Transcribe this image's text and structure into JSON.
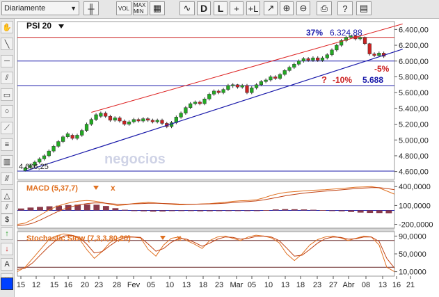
{
  "toolbar": {
    "period_label": "Diariamente",
    "buttons": [
      {
        "name": "candlestick-button",
        "label": "╫"
      },
      {
        "name": "volume-button",
        "label": "VOL"
      },
      {
        "name": "max-min-button",
        "label": "MAX MIN"
      },
      {
        "name": "grid-button",
        "label": "▦"
      },
      {
        "name": "indicators-button",
        "label": "∿"
      },
      {
        "name": "draw-button",
        "label": "D"
      },
      {
        "name": "line-button",
        "label": "L"
      },
      {
        "name": "crosshair-button",
        "label": "+"
      },
      {
        "name": "crosshair-label-button",
        "label": "+L"
      },
      {
        "name": "trend-button",
        "label": "↗"
      },
      {
        "name": "zoom-in-button",
        "label": "⊕"
      },
      {
        "name": "zoom-out-button",
        "label": "⊖"
      },
      {
        "name": "print-button",
        "label": "⎙"
      },
      {
        "name": "help-button",
        "label": "?"
      },
      {
        "name": "settings-button",
        "label": "▤"
      }
    ]
  },
  "sidebar": {
    "tools": [
      {
        "name": "hand-tool",
        "label": "✋"
      },
      {
        "name": "line-tool",
        "label": "╲"
      },
      {
        "name": "horizontal-line-tool",
        "label": "─"
      },
      {
        "name": "parallel-lines-tool",
        "label": "⫽"
      },
      {
        "name": "rectangle-tool",
        "label": "▭"
      },
      {
        "name": "circle-tool",
        "label": "○"
      },
      {
        "name": "fan-tool",
        "label": "⟋"
      },
      {
        "name": "fibonacci-tool",
        "label": "≡"
      },
      {
        "name": "fibonacci-grid-tool",
        "label": "▥"
      },
      {
        "name": "channel-tool",
        "label": "⫻"
      },
      {
        "name": "triangle-tool",
        "label": "△"
      },
      {
        "name": "channel2-tool",
        "label": "⫽"
      },
      {
        "name": "dollar-tool",
        "label": "$"
      },
      {
        "name": "buy-arrow-tool",
        "label": "↑"
      },
      {
        "name": "sell-arrow-tool",
        "label": "↓"
      },
      {
        "name": "text-tool",
        "label": "A"
      },
      {
        "name": "delete-tool",
        "label": "×"
      }
    ]
  },
  "chart_data": {
    "price": {
      "type": "candlestick",
      "title": "PSI 20",
      "ylim": [
        4500,
        6500
      ],
      "yticks": [
        "4.600,00",
        "4.800,00",
        "5.000,00",
        "5.200,00",
        "5.400,00",
        "5.600,00",
        "5.800,00",
        "6.000,00",
        "6.200,00",
        "6.400,00"
      ],
      "ytick_values": [
        4600,
        4800,
        5000,
        5200,
        5400,
        5600,
        5800,
        6000,
        6200,
        6400
      ],
      "xticks": [
        "15",
        "12",
        "15",
        "16",
        "20",
        "23",
        "28",
        "Fev",
        "05",
        "10",
        "13",
        "18",
        "23",
        "Mar",
        "05",
        "10",
        "13",
        "18",
        "23",
        "27",
        "Abr",
        "08",
        "13",
        "16",
        "21"
      ],
      "candles": [
        [
          4610,
          4650,
          4600,
          4660
        ],
        [
          4650,
          4680,
          4640,
          4700
        ],
        [
          4680,
          4720,
          4660,
          4740
        ],
        [
          4720,
          4760,
          4700,
          4780
        ],
        [
          4760,
          4800,
          4740,
          4820
        ],
        [
          4800,
          4860,
          4780,
          4880
        ],
        [
          4860,
          4920,
          4840,
          4940
        ],
        [
          4920,
          4980,
          4900,
          5000
        ],
        [
          4980,
          5040,
          4960,
          5060
        ],
        [
          5040,
          5080,
          5020,
          5100
        ],
        [
          5060,
          5020,
          5000,
          5080
        ],
        [
          5020,
          5060,
          5000,
          5080
        ],
        [
          5060,
          5120,
          5040,
          5140
        ],
        [
          5120,
          5200,
          5100,
          5220
        ],
        [
          5200,
          5260,
          5180,
          5280
        ],
        [
          5260,
          5320,
          5240,
          5340
        ],
        [
          5300,
          5340,
          5280,
          5360
        ],
        [
          5340,
          5300,
          5280,
          5360
        ],
        [
          5300,
          5250,
          5230,
          5320
        ],
        [
          5250,
          5280,
          5230,
          5300
        ],
        [
          5280,
          5240,
          5220,
          5300
        ],
        [
          5240,
          5200,
          5180,
          5260
        ],
        [
          5200,
          5230,
          5180,
          5250
        ],
        [
          5230,
          5260,
          5210,
          5280
        ],
        [
          5260,
          5240,
          5220,
          5280
        ],
        [
          5240,
          5270,
          5220,
          5290
        ],
        [
          5270,
          5250,
          5230,
          5290
        ],
        [
          5250,
          5230,
          5210,
          5270
        ],
        [
          5230,
          5250,
          5210,
          5270
        ],
        [
          5250,
          5210,
          5190,
          5270
        ],
        [
          5210,
          5170,
          5150,
          5230
        ],
        [
          5170,
          5220,
          5150,
          5240
        ],
        [
          5220,
          5290,
          5200,
          5310
        ],
        [
          5290,
          5340,
          5270,
          5360
        ],
        [
          5340,
          5410,
          5320,
          5430
        ],
        [
          5410,
          5460,
          5390,
          5480
        ],
        [
          5460,
          5480,
          5440,
          5500
        ],
        [
          5480,
          5460,
          5440,
          5500
        ],
        [
          5460,
          5520,
          5440,
          5540
        ],
        [
          5520,
          5580,
          5500,
          5600
        ],
        [
          5580,
          5620,
          5560,
          5640
        ],
        [
          5620,
          5600,
          5580,
          5640
        ],
        [
          5600,
          5640,
          5580,
          5660
        ],
        [
          5640,
          5690,
          5620,
          5710
        ],
        [
          5690,
          5700,
          5660,
          5720
        ],
        [
          5700,
          5670,
          5650,
          5710
        ],
        [
          5670,
          5690,
          5650,
          5710
        ],
        [
          5690,
          5600,
          5580,
          5710
        ],
        [
          5600,
          5660,
          5580,
          5680
        ],
        [
          5660,
          5700,
          5640,
          5720
        ],
        [
          5700,
          5740,
          5680,
          5760
        ],
        [
          5740,
          5760,
          5720,
          5780
        ],
        [
          5760,
          5800,
          5740,
          5820
        ],
        [
          5800,
          5780,
          5760,
          5820
        ],
        [
          5780,
          5830,
          5760,
          5850
        ],
        [
          5830,
          5880,
          5810,
          5900
        ],
        [
          5880,
          5920,
          5860,
          5940
        ],
        [
          5920,
          5960,
          5900,
          5980
        ],
        [
          5960,
          6000,
          5940,
          6020
        ],
        [
          6000,
          6030,
          5980,
          6050
        ],
        [
          6030,
          6010,
          5990,
          6050
        ],
        [
          6010,
          6040,
          5990,
          6060
        ],
        [
          6040,
          6010,
          5990,
          6060
        ],
        [
          6010,
          6040,
          5990,
          6060
        ],
        [
          6040,
          6080,
          6020,
          6100
        ],
        [
          6080,
          6140,
          6060,
          6160
        ],
        [
          6140,
          6200,
          6120,
          6220
        ],
        [
          6200,
          6260,
          6180,
          6280
        ],
        [
          6260,
          6300,
          6240,
          6320
        ],
        [
          6300,
          6320,
          6280,
          6324.88
        ],
        [
          6320,
          6280,
          6260,
          6324
        ],
        [
          6280,
          6300,
          6260,
          6320
        ],
        [
          6300,
          6220,
          6200,
          6310
        ],
        [
          6220,
          6090,
          6070,
          6230
        ],
        [
          6090,
          6070,
          6050,
          6110
        ],
        [
          6070,
          6100,
          6050,
          6120
        ],
        [
          6100,
          6060,
          6040,
          6120
        ]
      ],
      "annotations": {
        "high_pct": "37%",
        "high_value": "6.324,88",
        "minus5": "-5%",
        "question": "?",
        "minus10": "-10%",
        "target": "5.688",
        "low_value": "4.606,25"
      },
      "hlines": [
        6300,
        6000,
        5688,
        4606.25
      ],
      "channel_top": [
        [
          14,
          5350
        ],
        [
          80,
          6470
        ]
      ],
      "channel_bottom": [
        [
          0,
          4606
        ],
        [
          80,
          6150
        ]
      ],
      "watermark": "negocios"
    },
    "macd": {
      "title": "MACD (5,37,7)",
      "close_symbol": "x",
      "ylim": [
        -260000,
        480000
      ],
      "yticks": [
        "400,0000",
        "100,0000",
        "-200,0000"
      ],
      "ytick_values": [
        400000,
        100000,
        -200000
      ],
      "line": [
        -200000,
        -180000,
        -120000,
        -50000,
        20000,
        80000,
        120000,
        150000,
        170000,
        180000,
        170000,
        150000,
        120000,
        100000,
        110000,
        130000,
        140000,
        150000,
        140000,
        130000,
        120000,
        110000,
        115000,
        120000,
        125000,
        130000,
        140000,
        150000,
        165000,
        175000,
        180000,
        190000,
        220000,
        260000,
        290000,
        310000,
        320000,
        330000,
        340000,
        345000,
        350000,
        360000,
        370000,
        380000,
        390000,
        395000,
        400000,
        380000,
        330000,
        280000
      ],
      "signal": [
        -220000,
        -210000,
        -180000,
        -130000,
        -70000,
        -10000,
        40000,
        80000,
        110000,
        130000,
        140000,
        140000,
        130000,
        120000,
        120000,
        125000,
        130000,
        135000,
        135000,
        132000,
        128000,
        122000,
        120000,
        120000,
        122000,
        125000,
        130000,
        137000,
        146000,
        155000,
        163000,
        172000,
        188000,
        210000,
        235000,
        258000,
        276000,
        292000,
        306000,
        318000,
        328000,
        338000,
        348000,
        358000,
        368000,
        376000,
        384000,
        383000,
        370000,
        350000
      ],
      "hist": [
        30000,
        45000,
        55000,
        65000,
        75000,
        85000,
        90000,
        95000,
        90000,
        70000,
        35000,
        10000,
        -5000,
        -15000,
        -20000,
        -18000,
        -12000,
        -8000,
        -10000,
        -15000,
        -14000,
        -12000,
        -10000,
        -8000,
        -5000,
        -3000,
        5000,
        15000,
        20000,
        18000,
        15000,
        10000,
        5000,
        -5000,
        -15000,
        -25000,
        -35000,
        -40000,
        -42000,
        -45000
      ]
    },
    "stochastic": {
      "title": "Stochastic Slow (7,3,3,80,20)",
      "close_symbol": "x",
      "ylim": [
        0,
        100000
      ],
      "yticks": [
        "90,0000",
        "50,0000",
        "10,0000"
      ],
      "ytick_values": [
        90000,
        50000,
        10000
      ],
      "upper": 80000,
      "lower": 20000,
      "k": [
        10000,
        20000,
        40000,
        60000,
        80000,
        90000,
        95000,
        92000,
        85000,
        60000,
        40000,
        55000,
        75000,
        85000,
        90000,
        88000,
        86000,
        60000,
        45000,
        70000,
        85000,
        88000,
        80000,
        72000,
        62000,
        80000,
        88000,
        90000,
        85000,
        80000,
        88000,
        92000,
        90000,
        86000,
        75000,
        50000,
        35000,
        50000,
        70000,
        82000,
        88000,
        90000,
        86000,
        80000,
        85000,
        90000,
        88000,
        70000,
        20000,
        10000
      ],
      "d": [
        15000,
        18000,
        30000,
        48000,
        65000,
        80000,
        90000,
        92000,
        88000,
        72000,
        52000,
        55000,
        68000,
        80000,
        87000,
        88000,
        87000,
        72000,
        56000,
        62000,
        76000,
        85000,
        83000,
        76000,
        67000,
        74000,
        83000,
        88000,
        87000,
        83000,
        85000,
        89000,
        90000,
        88000,
        80000,
        63000,
        45000,
        47000,
        60000,
        74000,
        84000,
        88000,
        87000,
        83000,
        84000,
        88000,
        88000,
        78000,
        40000,
        18000
      ]
    }
  }
}
